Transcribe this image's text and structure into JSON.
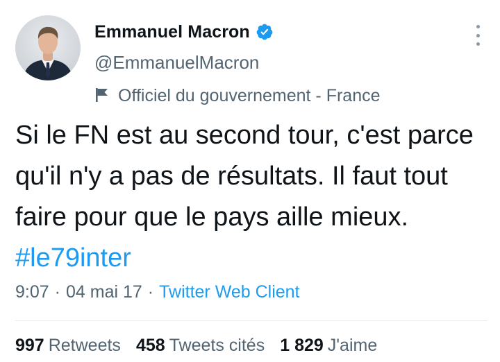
{
  "author": {
    "display_name": "Emmanuel Macron",
    "handle": "@EmmanuelMacron",
    "label": "Officiel du gouvernement - France",
    "avatar_icon": "profile-photo",
    "verified_icon": "verified-badge-icon",
    "label_icon": "flag-icon"
  },
  "tweet": {
    "text": "Si le FN est au second tour, c'est parce qu'il n'y a pas de résultats. Il faut tout faire pour que le pays aille mieux. ",
    "hashtag": "#le79inter",
    "time": "9:07",
    "separator": "·",
    "date": "04 mai 17",
    "client": "Twitter Web Client"
  },
  "stats": {
    "retweets_count": "997",
    "retweets_label": "Retweets",
    "quotes_count": "458",
    "quotes_label": "Tweets cités",
    "likes_count": "1 829",
    "likes_label": "J'aime"
  },
  "colors": {
    "link": "#1d9bf0",
    "secondary_text": "#536471",
    "primary_text": "#0f1419"
  }
}
